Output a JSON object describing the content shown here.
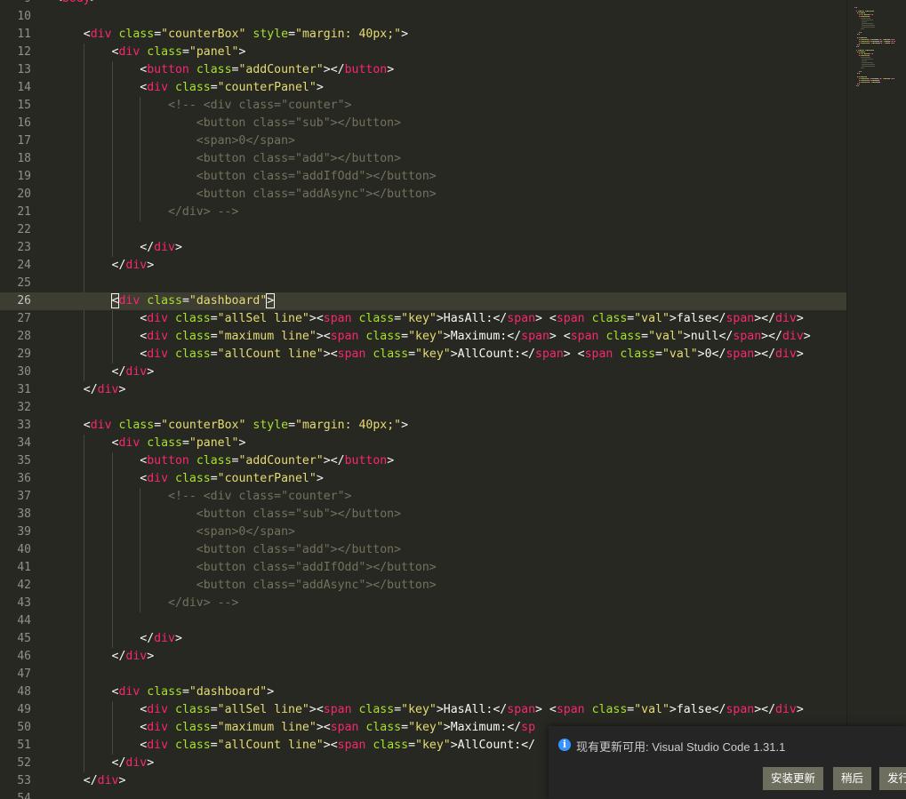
{
  "editor": {
    "first_line_number": 9,
    "active_line_number": 26,
    "lines": [
      {
        "n": "9",
        "tokens": [
          [
            "p",
            "<"
          ],
          [
            "t",
            "body"
          ],
          [
            "p",
            ">"
          ]
        ]
      },
      {
        "n": "10",
        "tokens": []
      },
      {
        "n": "11",
        "tokens": [
          [
            "p",
            "    <"
          ],
          [
            "t",
            "div"
          ],
          [
            "p",
            " "
          ],
          [
            "a",
            "class"
          ],
          [
            "p",
            "="
          ],
          [
            "s",
            "\"counterBox\""
          ],
          [
            "p",
            " "
          ],
          [
            "a",
            "style"
          ],
          [
            "p",
            "="
          ],
          [
            "s",
            "\"margin: 40px;\""
          ],
          [
            "p",
            ">"
          ]
        ]
      },
      {
        "n": "12",
        "tokens": [
          [
            "p",
            "        <"
          ],
          [
            "t",
            "div"
          ],
          [
            "p",
            " "
          ],
          [
            "a",
            "class"
          ],
          [
            "p",
            "="
          ],
          [
            "s",
            "\"panel\""
          ],
          [
            "p",
            ">"
          ]
        ]
      },
      {
        "n": "13",
        "tokens": [
          [
            "p",
            "            <"
          ],
          [
            "t",
            "button"
          ],
          [
            "p",
            " "
          ],
          [
            "a",
            "class"
          ],
          [
            "p",
            "="
          ],
          [
            "s",
            "\"addCounter\""
          ],
          [
            "p",
            "></"
          ],
          [
            "t",
            "button"
          ],
          [
            "p",
            ">"
          ]
        ]
      },
      {
        "n": "14",
        "tokens": [
          [
            "p",
            "            <"
          ],
          [
            "t",
            "div"
          ],
          [
            "p",
            " "
          ],
          [
            "a",
            "class"
          ],
          [
            "p",
            "="
          ],
          [
            "s",
            "\"counterPanel\""
          ],
          [
            "p",
            ">"
          ]
        ]
      },
      {
        "n": "15",
        "tokens": [
          [
            "c",
            "                <!-- <div class=\"counter\">"
          ]
        ]
      },
      {
        "n": "16",
        "tokens": [
          [
            "c",
            "                    <button class=\"sub\"></button>"
          ]
        ]
      },
      {
        "n": "17",
        "tokens": [
          [
            "c",
            "                    <span>0</span>"
          ]
        ]
      },
      {
        "n": "18",
        "tokens": [
          [
            "c",
            "                    <button class=\"add\"></button>"
          ]
        ]
      },
      {
        "n": "19",
        "tokens": [
          [
            "c",
            "                    <button class=\"addIfOdd\"></button>"
          ]
        ]
      },
      {
        "n": "20",
        "tokens": [
          [
            "c",
            "                    <button class=\"addAsync\"></button>"
          ]
        ]
      },
      {
        "n": "21",
        "tokens": [
          [
            "c",
            "                </div> -->"
          ]
        ]
      },
      {
        "n": "22",
        "tokens": []
      },
      {
        "n": "23",
        "tokens": [
          [
            "p",
            "            </"
          ],
          [
            "t",
            "div"
          ],
          [
            "p",
            ">"
          ]
        ]
      },
      {
        "n": "24",
        "tokens": [
          [
            "p",
            "        </"
          ],
          [
            "t",
            "div"
          ],
          [
            "p",
            ">"
          ]
        ]
      },
      {
        "n": "25",
        "tokens": []
      },
      {
        "n": "26",
        "tokens": [
          [
            "p",
            "        "
          ],
          [
            "cur",
            "<"
          ],
          [
            "t",
            "div"
          ],
          [
            "p",
            " "
          ],
          [
            "a",
            "class"
          ],
          [
            "p",
            "="
          ],
          [
            "s",
            "\"dashboard\""
          ],
          [
            "cur",
            ">"
          ]
        ]
      },
      {
        "n": "27",
        "tokens": [
          [
            "p",
            "            <"
          ],
          [
            "t",
            "div"
          ],
          [
            "p",
            " "
          ],
          [
            "a",
            "class"
          ],
          [
            "p",
            "="
          ],
          [
            "s",
            "\"allSel line\""
          ],
          [
            "p",
            "><"
          ],
          [
            "t",
            "span"
          ],
          [
            "p",
            " "
          ],
          [
            "a",
            "class"
          ],
          [
            "p",
            "="
          ],
          [
            "s",
            "\"key\""
          ],
          [
            "p",
            ">HasAll:</"
          ],
          [
            "t",
            "span"
          ],
          [
            "p",
            "> <"
          ],
          [
            "t",
            "span"
          ],
          [
            "p",
            " "
          ],
          [
            "a",
            "class"
          ],
          [
            "p",
            "="
          ],
          [
            "s",
            "\"val\""
          ],
          [
            "p",
            ">false</"
          ],
          [
            "t",
            "span"
          ],
          [
            "p",
            "></"
          ],
          [
            "t",
            "div"
          ],
          [
            "p",
            ">"
          ]
        ]
      },
      {
        "n": "28",
        "tokens": [
          [
            "p",
            "            <"
          ],
          [
            "t",
            "div"
          ],
          [
            "p",
            " "
          ],
          [
            "a",
            "class"
          ],
          [
            "p",
            "="
          ],
          [
            "s",
            "\"maximum line\""
          ],
          [
            "p",
            "><"
          ],
          [
            "t",
            "span"
          ],
          [
            "p",
            " "
          ],
          [
            "a",
            "class"
          ],
          [
            "p",
            "="
          ],
          [
            "s",
            "\"key\""
          ],
          [
            "p",
            ">Maximum:</"
          ],
          [
            "t",
            "span"
          ],
          [
            "p",
            "> <"
          ],
          [
            "t",
            "span"
          ],
          [
            "p",
            " "
          ],
          [
            "a",
            "class"
          ],
          [
            "p",
            "="
          ],
          [
            "s",
            "\"val\""
          ],
          [
            "p",
            ">null</"
          ],
          [
            "t",
            "span"
          ],
          [
            "p",
            "></"
          ],
          [
            "t",
            "div"
          ],
          [
            "p",
            ">"
          ]
        ]
      },
      {
        "n": "29",
        "tokens": [
          [
            "p",
            "            <"
          ],
          [
            "t",
            "div"
          ],
          [
            "p",
            " "
          ],
          [
            "a",
            "class"
          ],
          [
            "p",
            "="
          ],
          [
            "s",
            "\"allCount line\""
          ],
          [
            "p",
            "><"
          ],
          [
            "t",
            "span"
          ],
          [
            "p",
            " "
          ],
          [
            "a",
            "class"
          ],
          [
            "p",
            "="
          ],
          [
            "s",
            "\"key\""
          ],
          [
            "p",
            ">AllCount:</"
          ],
          [
            "t",
            "span"
          ],
          [
            "p",
            "> <"
          ],
          [
            "t",
            "span"
          ],
          [
            "p",
            " "
          ],
          [
            "a",
            "class"
          ],
          [
            "p",
            "="
          ],
          [
            "s",
            "\"val\""
          ],
          [
            "p",
            ">0</"
          ],
          [
            "t",
            "span"
          ],
          [
            "p",
            "></"
          ],
          [
            "t",
            "div"
          ],
          [
            "p",
            ">"
          ]
        ]
      },
      {
        "n": "30",
        "tokens": [
          [
            "p",
            "        </"
          ],
          [
            "t",
            "div"
          ],
          [
            "p",
            ">"
          ]
        ]
      },
      {
        "n": "31",
        "tokens": [
          [
            "p",
            "    </"
          ],
          [
            "t",
            "div"
          ],
          [
            "p",
            ">"
          ]
        ]
      },
      {
        "n": "32",
        "tokens": []
      },
      {
        "n": "33",
        "tokens": [
          [
            "p",
            "    <"
          ],
          [
            "t",
            "div"
          ],
          [
            "p",
            " "
          ],
          [
            "a",
            "class"
          ],
          [
            "p",
            "="
          ],
          [
            "s",
            "\"counterBox\""
          ],
          [
            "p",
            " "
          ],
          [
            "a",
            "style"
          ],
          [
            "p",
            "="
          ],
          [
            "s",
            "\"margin: 40px;\""
          ],
          [
            "p",
            ">"
          ]
        ]
      },
      {
        "n": "34",
        "tokens": [
          [
            "p",
            "        <"
          ],
          [
            "t",
            "div"
          ],
          [
            "p",
            " "
          ],
          [
            "a",
            "class"
          ],
          [
            "p",
            "="
          ],
          [
            "s",
            "\"panel\""
          ],
          [
            "p",
            ">"
          ]
        ]
      },
      {
        "n": "35",
        "tokens": [
          [
            "p",
            "            <"
          ],
          [
            "t",
            "button"
          ],
          [
            "p",
            " "
          ],
          [
            "a",
            "class"
          ],
          [
            "p",
            "="
          ],
          [
            "s",
            "\"addCounter\""
          ],
          [
            "p",
            "></"
          ],
          [
            "t",
            "button"
          ],
          [
            "p",
            ">"
          ]
        ]
      },
      {
        "n": "36",
        "tokens": [
          [
            "p",
            "            <"
          ],
          [
            "t",
            "div"
          ],
          [
            "p",
            " "
          ],
          [
            "a",
            "class"
          ],
          [
            "p",
            "="
          ],
          [
            "s",
            "\"counterPanel\""
          ],
          [
            "p",
            ">"
          ]
        ]
      },
      {
        "n": "37",
        "tokens": [
          [
            "c",
            "                <!-- <div class=\"counter\">"
          ]
        ]
      },
      {
        "n": "38",
        "tokens": [
          [
            "c",
            "                    <button class=\"sub\"></button>"
          ]
        ]
      },
      {
        "n": "39",
        "tokens": [
          [
            "c",
            "                    <span>0</span>"
          ]
        ]
      },
      {
        "n": "40",
        "tokens": [
          [
            "c",
            "                    <button class=\"add\"></button>"
          ]
        ]
      },
      {
        "n": "41",
        "tokens": [
          [
            "c",
            "                    <button class=\"addIfOdd\"></button>"
          ]
        ]
      },
      {
        "n": "42",
        "tokens": [
          [
            "c",
            "                    <button class=\"addAsync\"></button>"
          ]
        ]
      },
      {
        "n": "43",
        "tokens": [
          [
            "c",
            "                </div> -->"
          ]
        ]
      },
      {
        "n": "44",
        "tokens": []
      },
      {
        "n": "45",
        "tokens": [
          [
            "p",
            "            </"
          ],
          [
            "t",
            "div"
          ],
          [
            "p",
            ">"
          ]
        ]
      },
      {
        "n": "46",
        "tokens": [
          [
            "p",
            "        </"
          ],
          [
            "t",
            "div"
          ],
          [
            "p",
            ">"
          ]
        ]
      },
      {
        "n": "47",
        "tokens": []
      },
      {
        "n": "48",
        "tokens": [
          [
            "p",
            "        <"
          ],
          [
            "t",
            "div"
          ],
          [
            "p",
            " "
          ],
          [
            "a",
            "class"
          ],
          [
            "p",
            "="
          ],
          [
            "s",
            "\"dashboard\""
          ],
          [
            "p",
            ">"
          ]
        ]
      },
      {
        "n": "49",
        "tokens": [
          [
            "p",
            "            <"
          ],
          [
            "t",
            "div"
          ],
          [
            "p",
            " "
          ],
          [
            "a",
            "class"
          ],
          [
            "p",
            "="
          ],
          [
            "s",
            "\"allSel line\""
          ],
          [
            "p",
            "><"
          ],
          [
            "t",
            "span"
          ],
          [
            "p",
            " "
          ],
          [
            "a",
            "class"
          ],
          [
            "p",
            "="
          ],
          [
            "s",
            "\"key\""
          ],
          [
            "p",
            ">HasAll:</"
          ],
          [
            "t",
            "span"
          ],
          [
            "p",
            "> <"
          ],
          [
            "t",
            "span"
          ],
          [
            "p",
            " "
          ],
          [
            "a",
            "class"
          ],
          [
            "p",
            "="
          ],
          [
            "s",
            "\"val\""
          ],
          [
            "p",
            ">false</"
          ],
          [
            "t",
            "span"
          ],
          [
            "p",
            "></"
          ],
          [
            "t",
            "div"
          ],
          [
            "p",
            ">"
          ]
        ]
      },
      {
        "n": "50",
        "tokens": [
          [
            "p",
            "            <"
          ],
          [
            "t",
            "div"
          ],
          [
            "p",
            " "
          ],
          [
            "a",
            "class"
          ],
          [
            "p",
            "="
          ],
          [
            "s",
            "\"maximum line\""
          ],
          [
            "p",
            "><"
          ],
          [
            "t",
            "span"
          ],
          [
            "p",
            " "
          ],
          [
            "a",
            "class"
          ],
          [
            "p",
            "="
          ],
          [
            "s",
            "\"key\""
          ],
          [
            "p",
            ">Maximum:</"
          ],
          [
            "t",
            "sp"
          ]
        ]
      },
      {
        "n": "51",
        "tokens": [
          [
            "p",
            "            <"
          ],
          [
            "t",
            "div"
          ],
          [
            "p",
            " "
          ],
          [
            "a",
            "class"
          ],
          [
            "p",
            "="
          ],
          [
            "s",
            "\"allCount line\""
          ],
          [
            "p",
            "><"
          ],
          [
            "t",
            "span"
          ],
          [
            "p",
            " "
          ],
          [
            "a",
            "class"
          ],
          [
            "p",
            "="
          ],
          [
            "s",
            "\"key\""
          ],
          [
            "p",
            ">AllCount:</"
          ]
        ]
      },
      {
        "n": "52",
        "tokens": [
          [
            "p",
            "        </"
          ],
          [
            "t",
            "div"
          ],
          [
            "p",
            ">"
          ]
        ]
      },
      {
        "n": "53",
        "tokens": [
          [
            "p",
            "    </"
          ],
          [
            "t",
            "div"
          ],
          [
            "p",
            ">"
          ]
        ]
      },
      {
        "n": "54",
        "tokens": []
      }
    ]
  },
  "notification": {
    "icon": "info-icon",
    "icon_glyph": "i",
    "message": "现有更新可用: Visual Studio Code 1.31.1",
    "buttons": [
      {
        "name": "install-update-button",
        "label": "安装更新"
      },
      {
        "name": "later-button",
        "label": "稍后"
      },
      {
        "name": "release-notes-button",
        "label": "发行"
      }
    ]
  },
  "theme": {
    "background": "#272822",
    "tag": "#f92672",
    "attribute": "#a6e22e",
    "string": "#e6db74",
    "comment": "#75715e",
    "plain": "#f8f8f2",
    "notification_background": "#252526",
    "button_background": "#6e6e5e",
    "info_icon": "#3794ff"
  }
}
